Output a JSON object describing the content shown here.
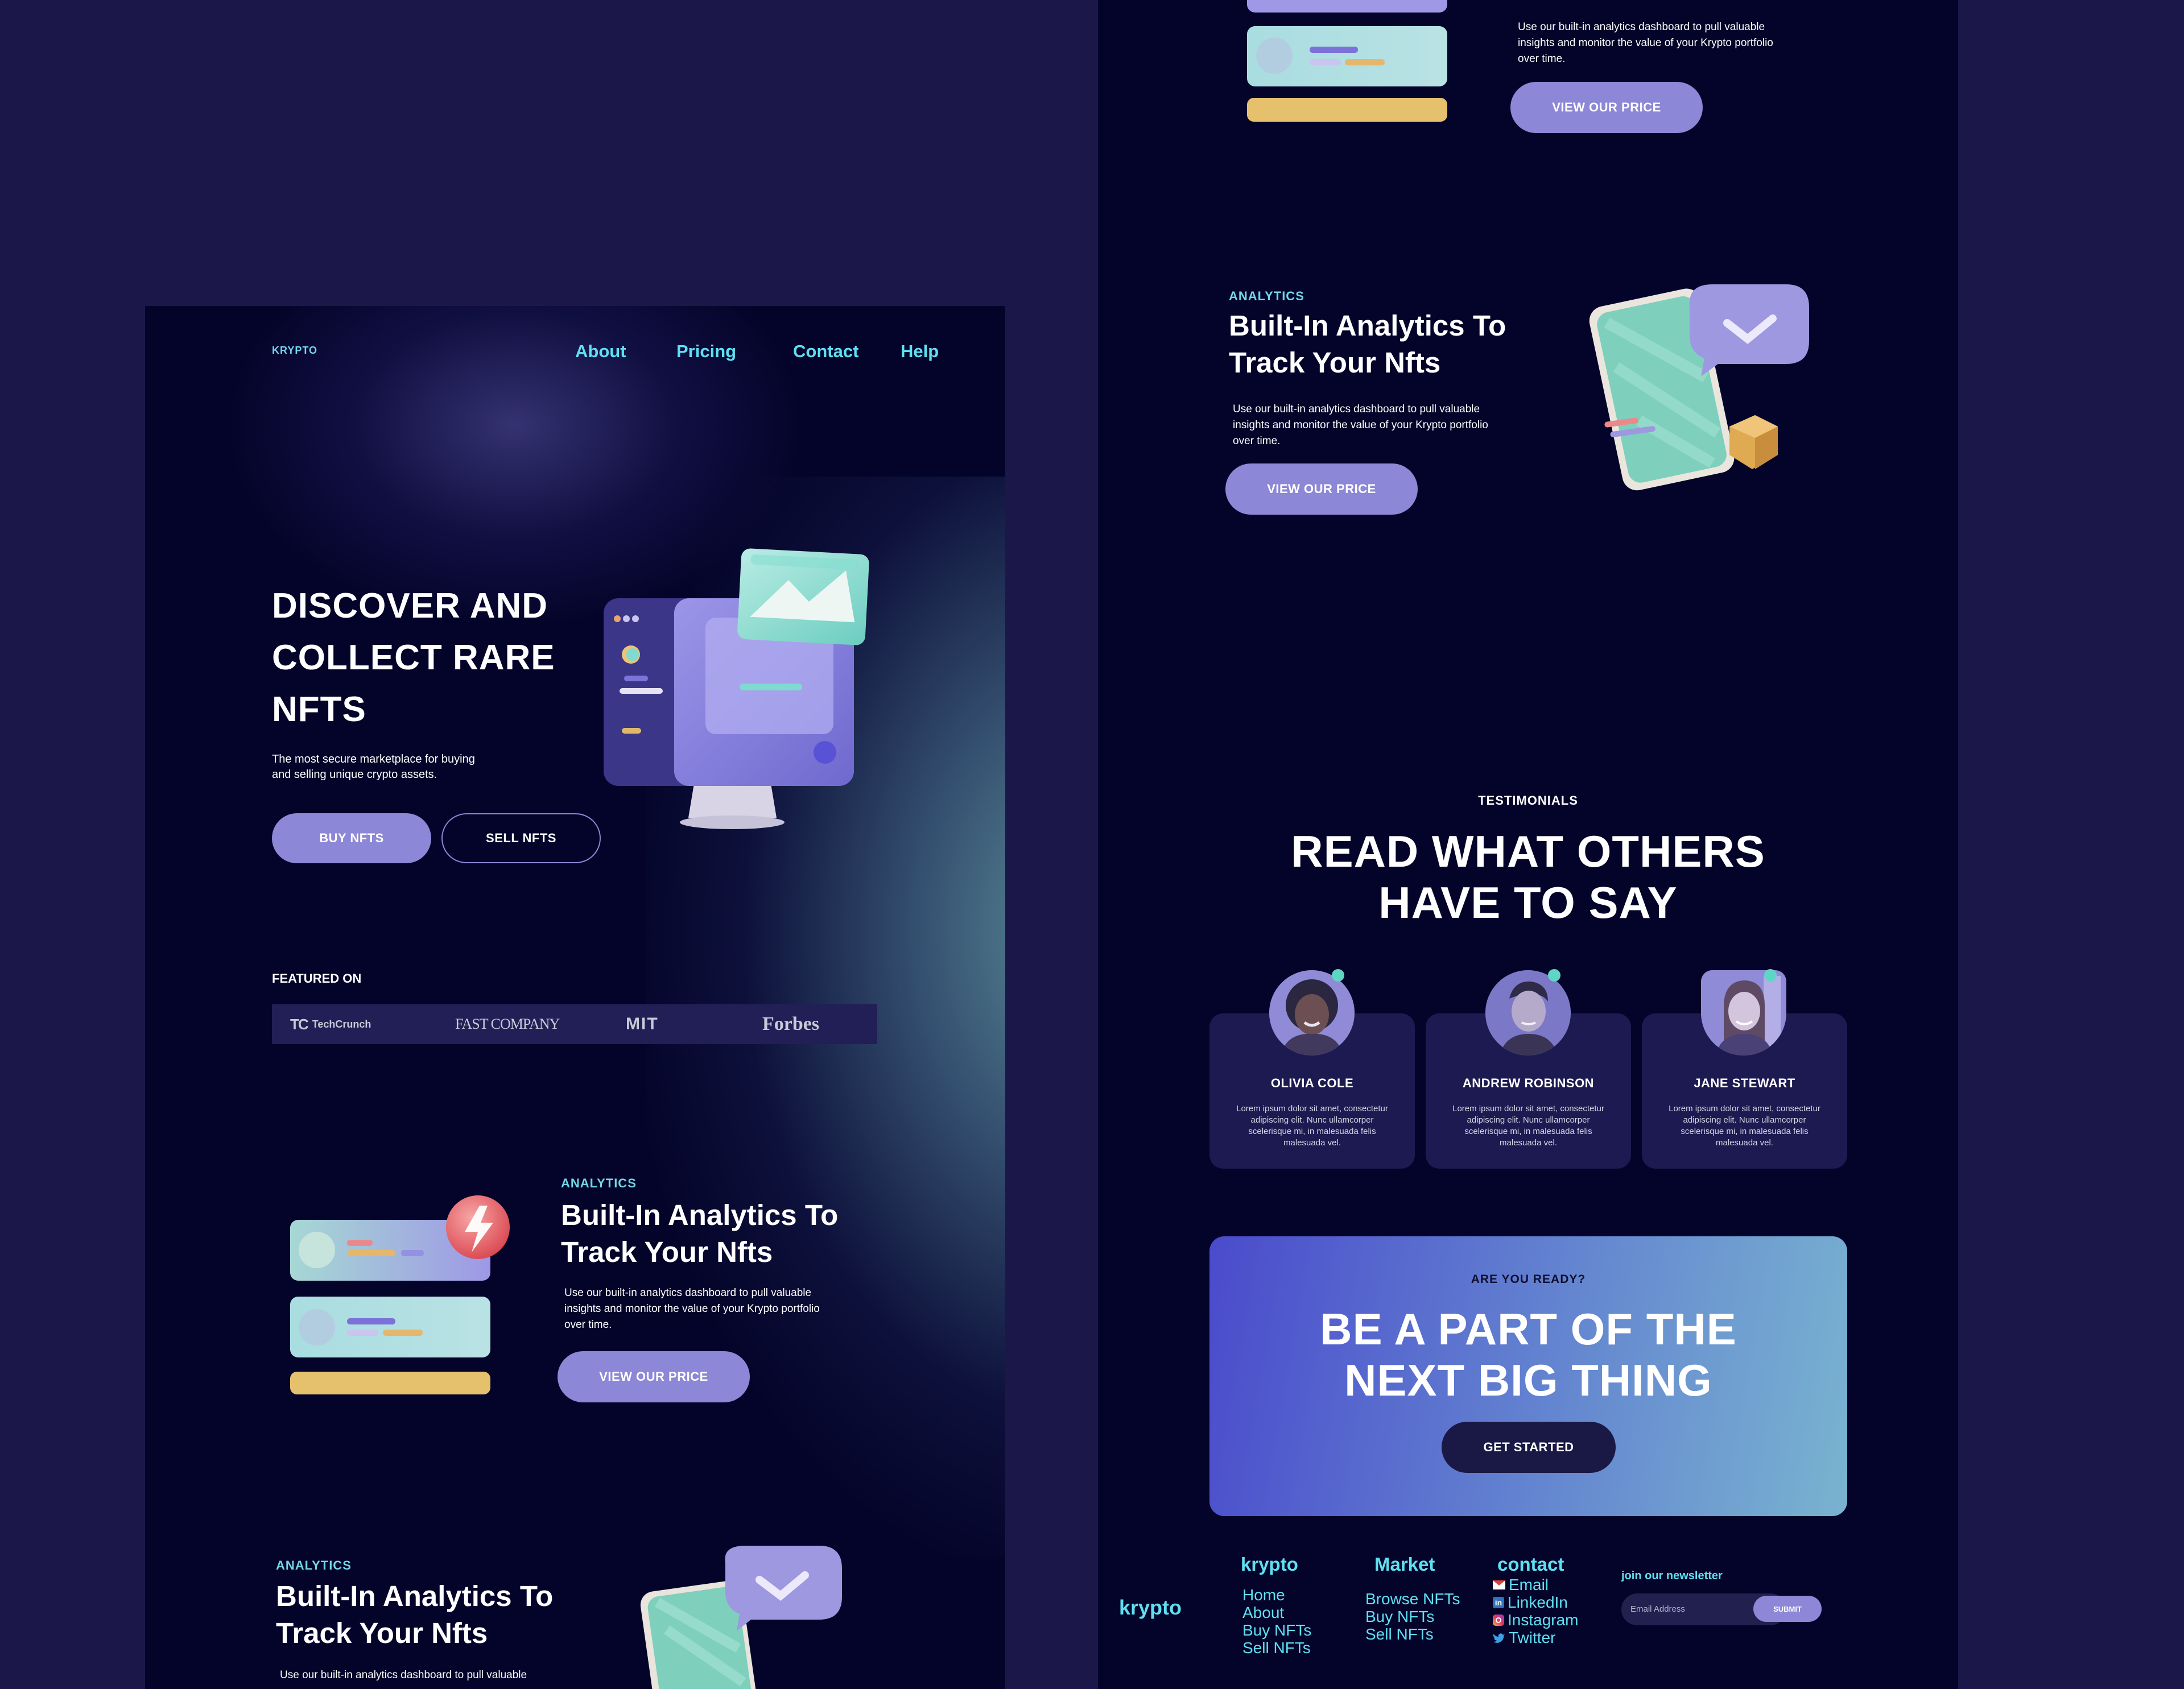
{
  "left": {
    "brand": "KRYPTO",
    "nav": [
      "About",
      "Pricing",
      "Contact",
      "Help"
    ],
    "hero": {
      "title_lines": [
        "DISCOVER AND",
        "COLLECT RARE",
        "NFTS"
      ],
      "subtitle_lines": [
        "The most secure marketplace for buying",
        "and selling unique crypto assets."
      ],
      "buy_label": "BUY NFTS",
      "sell_label": "SELL NFTS"
    },
    "featured": {
      "label": "FEATURED ON",
      "brands": [
        "TechCrunch",
        "FAST COMPANY",
        "MIT",
        "Forbes"
      ]
    },
    "analytics1": {
      "eyebrow": "ANALYTICS",
      "title_lines": [
        "Built-In Analytics To",
        "Track Your Nfts"
      ],
      "body_lines": [
        "Use our built-in analytics dashboard to pull valuable",
        "insights and monitor the value of your Krypto portfolio",
        "over time."
      ],
      "button": "VIEW OUR PRICE"
    },
    "analytics2": {
      "eyebrow": "ANALYTICS",
      "title_lines": [
        "Built-In Analytics To",
        "Track Your Nfts"
      ],
      "body_lines": [
        "Use our built-in analytics dashboard to pull valuable"
      ]
    }
  },
  "right": {
    "analytics_top": {
      "body_lines": [
        "Use our built-in analytics dashboard to pull valuable",
        "insights and monitor the value of your Krypto portfolio",
        "over time."
      ],
      "button": "VIEW OUR PRICE"
    },
    "analytics": {
      "eyebrow": "ANALYTICS",
      "title_lines": [
        "Built-In Analytics To",
        "Track Your Nfts"
      ],
      "body_lines": [
        "Use our built-in analytics dashboard to pull valuable",
        "insights and monitor the value of your Krypto portfolio",
        "over time."
      ],
      "button": "VIEW OUR PRICE"
    },
    "testimonials": {
      "eyebrow": "TESTIMONIALS",
      "title_lines": [
        "READ WHAT OTHERS",
        "HAVE TO SAY"
      ],
      "cards": [
        {
          "name": "OLIVIA COLE",
          "text": [
            "Lorem ipsum dolor sit amet, consectetur",
            "adipiscing elit. Nunc ullamcorper",
            "scelerisque mi, in malesuada felis",
            "malesuada vel."
          ]
        },
        {
          "name": "ANDREW ROBINSON",
          "text": [
            "Lorem ipsum dolor sit amet, consectetur",
            "adipiscing elit. Nunc ullamcorper",
            "scelerisque mi, in malesuada felis",
            "malesuada vel."
          ]
        },
        {
          "name": "JANE STEWART",
          "text": [
            "Lorem ipsum dolor sit amet, consectetur",
            "adipiscing elit. Nunc ullamcorper",
            "scelerisque mi, in malesuada felis",
            "malesuada vel."
          ]
        }
      ]
    },
    "cta": {
      "eyebrow": "ARE YOU READY?",
      "title_lines": [
        "BE A PART OF THE",
        "NEXT BIG THING"
      ],
      "button": "GET STARTED"
    },
    "footer": {
      "logo": "krypto",
      "col1": {
        "heading": "krypto",
        "links": [
          "Home",
          "About",
          "Buy NFTs",
          "Sell NFTs"
        ]
      },
      "col2": {
        "heading": "Market",
        "links": [
          "Browse NFTs",
          "Buy NFTs",
          "Sell NFTs"
        ]
      },
      "col3": {
        "heading": "contact",
        "links": [
          "Email",
          "LinkedIn",
          "Instagram",
          "Twitter"
        ]
      },
      "newsletter": {
        "label": "join our newsletter",
        "placeholder": "Email Address",
        "button": "SUBMIT"
      }
    }
  },
  "colors": {
    "background": "#1b1849",
    "panel": "#04042a",
    "accent_cyan": "#5fe0f1",
    "lavender": "#8c87d6",
    "card": "#1c1a50"
  }
}
